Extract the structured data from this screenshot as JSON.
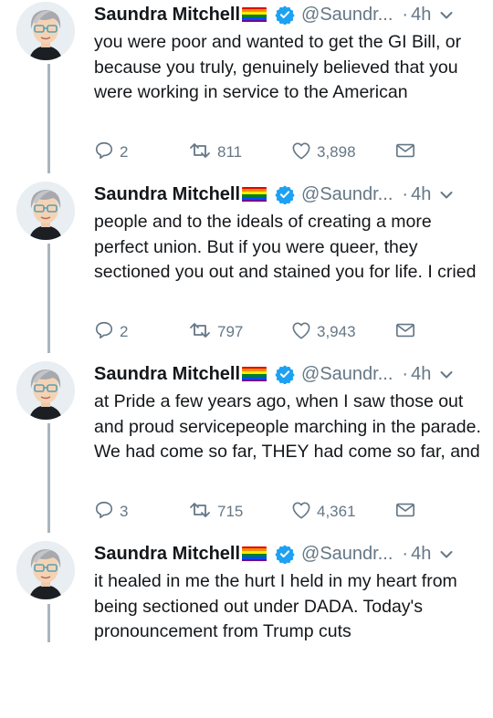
{
  "colors": {
    "text": "#14171a",
    "secondary": "#657786",
    "verified": "#1da1f2",
    "thread_line": "#a9b5bf",
    "pride_flag": [
      "#e40303",
      "#ff8c00",
      "#ffed00",
      "#008026",
      "#004dff",
      "#750787"
    ]
  },
  "icons": {
    "author_badge": "rainbow-flag-icon",
    "verified": "verified-badge-icon",
    "menu": "chevron-down-icon",
    "reply": "reply-icon",
    "retweet": "retweet-icon",
    "like": "heart-icon",
    "message": "envelope-icon"
  },
  "tweets": [
    {
      "author": "Saundra Mitchell",
      "handle": "@Saundr...",
      "separator": "·",
      "time": "4h",
      "text": "you were poor and wanted to get the GI Bill, or because you truly, genuinely believed that you were working in service to the American",
      "replies": "2",
      "retweets": "811",
      "likes": "3,898"
    },
    {
      "author": "Saundra Mitchell",
      "handle": "@Saundr...",
      "separator": "·",
      "time": "4h",
      "text": "people and to the ideals of creating a more perfect union. But if you were queer, they sectioned you out and stained you for life. I cried",
      "replies": "2",
      "retweets": "797",
      "likes": "3,943"
    },
    {
      "author": "Saundra Mitchell",
      "handle": "@Saundr...",
      "separator": "·",
      "time": "4h",
      "text": "at Pride a few years ago, when I saw those out and proud servicepeople marching in the parade. We had come so far, THEY had come so far, and",
      "replies": "3",
      "retweets": "715",
      "likes": "4,361"
    },
    {
      "author": "Saundra Mitchell",
      "handle": "@Saundr...",
      "separator": "·",
      "time": "4h",
      "text": "it healed in me the hurt I held in my heart from being sectioned out under DADA. Today's pronouncement from Trump cuts",
      "replies": "",
      "retweets": "",
      "likes": ""
    }
  ]
}
